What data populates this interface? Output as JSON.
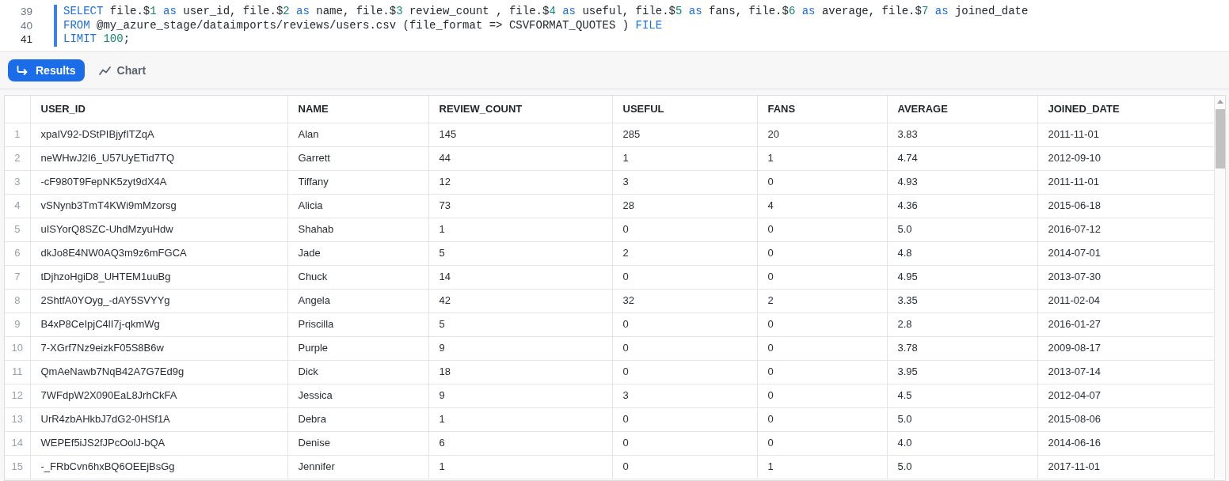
{
  "editor": {
    "lines": [
      {
        "number": "39",
        "active": false,
        "selected": true,
        "tokens": [
          {
            "kind": "keyword",
            "text": "SELECT"
          },
          {
            "kind": "plain",
            "text": " file.$"
          },
          {
            "kind": "number",
            "text": "1"
          },
          {
            "kind": "keyword",
            "text": " as"
          },
          {
            "kind": "plain",
            "text": " user_id, file.$"
          },
          {
            "kind": "number",
            "text": "2"
          },
          {
            "kind": "keyword",
            "text": " as"
          },
          {
            "kind": "plain",
            "text": " name, file.$"
          },
          {
            "kind": "number",
            "text": "3"
          },
          {
            "kind": "plain",
            "text": " review_count , file.$"
          },
          {
            "kind": "number",
            "text": "4"
          },
          {
            "kind": "keyword",
            "text": " as"
          },
          {
            "kind": "plain",
            "text": " useful, file.$"
          },
          {
            "kind": "number",
            "text": "5"
          },
          {
            "kind": "keyword",
            "text": " as"
          },
          {
            "kind": "plain",
            "text": " fans, file.$"
          },
          {
            "kind": "number",
            "text": "6"
          },
          {
            "kind": "keyword",
            "text": " as"
          },
          {
            "kind": "plain",
            "text": " average, file.$"
          },
          {
            "kind": "number",
            "text": "7"
          },
          {
            "kind": "keyword",
            "text": " as"
          },
          {
            "kind": "plain",
            "text": " joined_date"
          }
        ]
      },
      {
        "number": "40",
        "active": false,
        "selected": true,
        "tokens": [
          {
            "kind": "keyword",
            "text": "FROM"
          },
          {
            "kind": "plain",
            "text": " @my_azure_stage/dataimports/reviews/users.csv (file_format => CSVFORMAT_QUOTES ) "
          },
          {
            "kind": "keyword",
            "text": "FILE"
          }
        ]
      },
      {
        "number": "41",
        "active": true,
        "selected": true,
        "tokens": [
          {
            "kind": "keyword",
            "text": "LIMIT"
          },
          {
            "kind": "number",
            "text": " 100"
          },
          {
            "kind": "plain",
            "text": ";"
          }
        ]
      }
    ]
  },
  "result_tabs": [
    {
      "kind": "results",
      "label": "Results",
      "selected": true
    },
    {
      "kind": "chart",
      "label": "Chart",
      "selected": false
    }
  ],
  "table": {
    "columns": [
      "USER_ID",
      "NAME",
      "REVIEW_COUNT",
      "USEFUL",
      "FANS",
      "AVERAGE",
      "JOINED_DATE"
    ],
    "rows": [
      {
        "index": "1",
        "cells": [
          "xpaIV92-DStPIBjyfITZqA",
          "Alan",
          "145",
          "285",
          "20",
          "3.83",
          "2011-11-01"
        ]
      },
      {
        "index": "2",
        "cells": [
          "neWHwJ2I6_U57UyETid7TQ",
          "Garrett",
          "44",
          "1",
          "1",
          "4.74",
          "2012-09-10"
        ]
      },
      {
        "index": "3",
        "cells": [
          "-cF980T9FepNK5zyt9dX4A",
          "Tiffany",
          "12",
          "3",
          "0",
          "4.93",
          "2011-11-01"
        ]
      },
      {
        "index": "4",
        "cells": [
          "vSNynb3TmT4KWi9mMzorsg",
          "Alicia",
          "73",
          "28",
          "4",
          "4.36",
          "2015-06-18"
        ]
      },
      {
        "index": "5",
        "cells": [
          "uISYorQ8SZC-UhdMzyuHdw",
          "Shahab",
          "1",
          "0",
          "0",
          "5.0",
          "2016-07-12"
        ]
      },
      {
        "index": "6",
        "cells": [
          "dkJo8E4NW0AQ3m9z6mFGCA",
          "Jade",
          "5",
          "2",
          "0",
          "4.8",
          "2014-07-01"
        ]
      },
      {
        "index": "7",
        "cells": [
          "tDjhzoHgiD8_UHTEM1uuBg",
          "Chuck",
          "14",
          "0",
          "0",
          "4.95",
          "2013-07-30"
        ]
      },
      {
        "index": "8",
        "cells": [
          "2ShtfA0YOyg_-dAY5SVYYg",
          "Angela",
          "42",
          "32",
          "2",
          "3.35",
          "2011-02-04"
        ]
      },
      {
        "index": "9",
        "cells": [
          "B4xP8CeIpjC4lI7j-qkmWg",
          "Priscilla",
          "5",
          "0",
          "0",
          "2.8",
          "2016-01-27"
        ]
      },
      {
        "index": "10",
        "cells": [
          "7-XGrf7Nz9eizkF05S8B6w",
          "Purple",
          "9",
          "0",
          "0",
          "3.78",
          "2009-08-17"
        ]
      },
      {
        "index": "11",
        "cells": [
          "QmAeNawb7NqB42A7G7Ed9g",
          "Dick",
          "18",
          "0",
          "0",
          "3.95",
          "2013-07-14"
        ]
      },
      {
        "index": "12",
        "cells": [
          "7WFdpW2X090EaL8JrhCkFA",
          "Jessica",
          "9",
          "3",
          "0",
          "4.5",
          "2012-04-07"
        ]
      },
      {
        "index": "13",
        "cells": [
          "UrR4zbAHkbJ7dG2-0HSf1A",
          "Debra",
          "1",
          "0",
          "0",
          "5.0",
          "2015-08-06"
        ]
      },
      {
        "index": "14",
        "cells": [
          "WEPEf5iJS2fJPcOolJ-bQA",
          "Denise",
          "6",
          "0",
          "0",
          "4.0",
          "2014-06-16"
        ]
      },
      {
        "index": "15",
        "cells": [
          "-_FRbCvn6hxBQ6OEEjBsGg",
          "Jennifer",
          "1",
          "0",
          "1",
          "5.0",
          "2017-11-01"
        ]
      }
    ]
  }
}
